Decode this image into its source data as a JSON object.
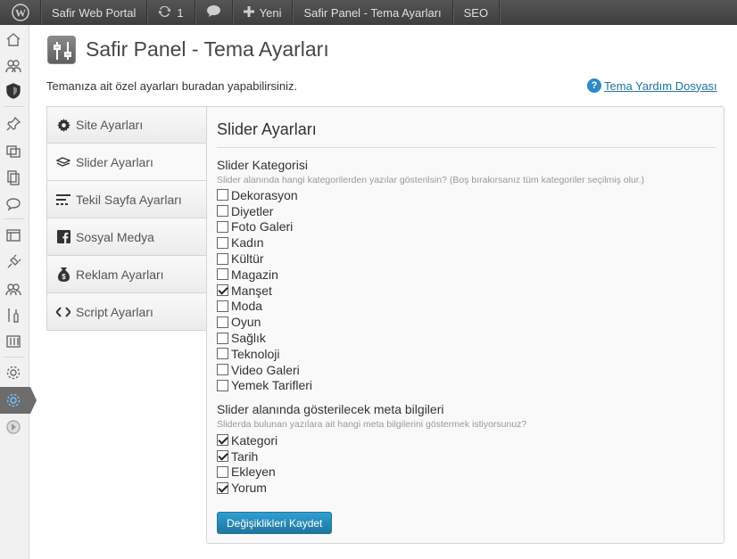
{
  "adminbar": {
    "site_name": "Safir Web Portal",
    "updates_count": "1",
    "new_label": "Yeni",
    "panel_link": "Safir Panel - Tema Ayarları",
    "seo_label": "SEO"
  },
  "page": {
    "title": "Safir Panel - Tema Ayarları",
    "intro": "Temanıza ait özel ayarları buradan yapabilirsiniz.",
    "help_link": "Tema Yardım Dosyası"
  },
  "tabs": [
    {
      "label": "Site Ayarları",
      "icon": "gear-icon"
    },
    {
      "label": "Slider Ayarları",
      "icon": "slider-icon",
      "active": true
    },
    {
      "label": "Tekil Sayfa Ayarları",
      "icon": "lines-icon"
    },
    {
      "label": "Sosyal Medya",
      "icon": "facebook-icon"
    },
    {
      "label": "Reklam Ayarları",
      "icon": "money-bag-icon"
    },
    {
      "label": "Script Ayarları",
      "icon": "code-icon"
    }
  ],
  "panel": {
    "title": "Slider Ayarları",
    "category_section": {
      "title": "Slider Kategorisi",
      "desc": "Slider alanında hangi kategorilerden yazılar gösterilsin? (Boş bırakırsanız tüm kategoriler seçilmiş olur.)",
      "items": [
        {
          "label": "Dekorasyon",
          "checked": false
        },
        {
          "label": "Diyetler",
          "checked": false
        },
        {
          "label": "Foto Galeri",
          "checked": false
        },
        {
          "label": "Kadın",
          "checked": false
        },
        {
          "label": "Kültür",
          "checked": false
        },
        {
          "label": "Magazin",
          "checked": false
        },
        {
          "label": "Manşet",
          "checked": true
        },
        {
          "label": "Moda",
          "checked": false
        },
        {
          "label": "Oyun",
          "checked": false
        },
        {
          "label": "Sağlık",
          "checked": false
        },
        {
          "label": "Teknoloji",
          "checked": false
        },
        {
          "label": "Video Galeri",
          "checked": false
        },
        {
          "label": "Yemek Tarifleri",
          "checked": false
        }
      ]
    },
    "meta_section": {
      "title": "Slider alanında gösterilecek meta bilgileri",
      "desc": "Sliderda bulunan yazılara ait hangi meta bilgilerini göstermek istiyorsunuz?",
      "items": [
        {
          "label": "Kategori",
          "checked": true
        },
        {
          "label": "Tarih",
          "checked": true
        },
        {
          "label": "Ekleyen",
          "checked": false
        },
        {
          "label": "Yorum",
          "checked": true
        }
      ]
    },
    "save_label": "Değişiklikleri Kaydet"
  },
  "colors": {
    "accent": "#21759b",
    "adminbar": "#464646"
  }
}
